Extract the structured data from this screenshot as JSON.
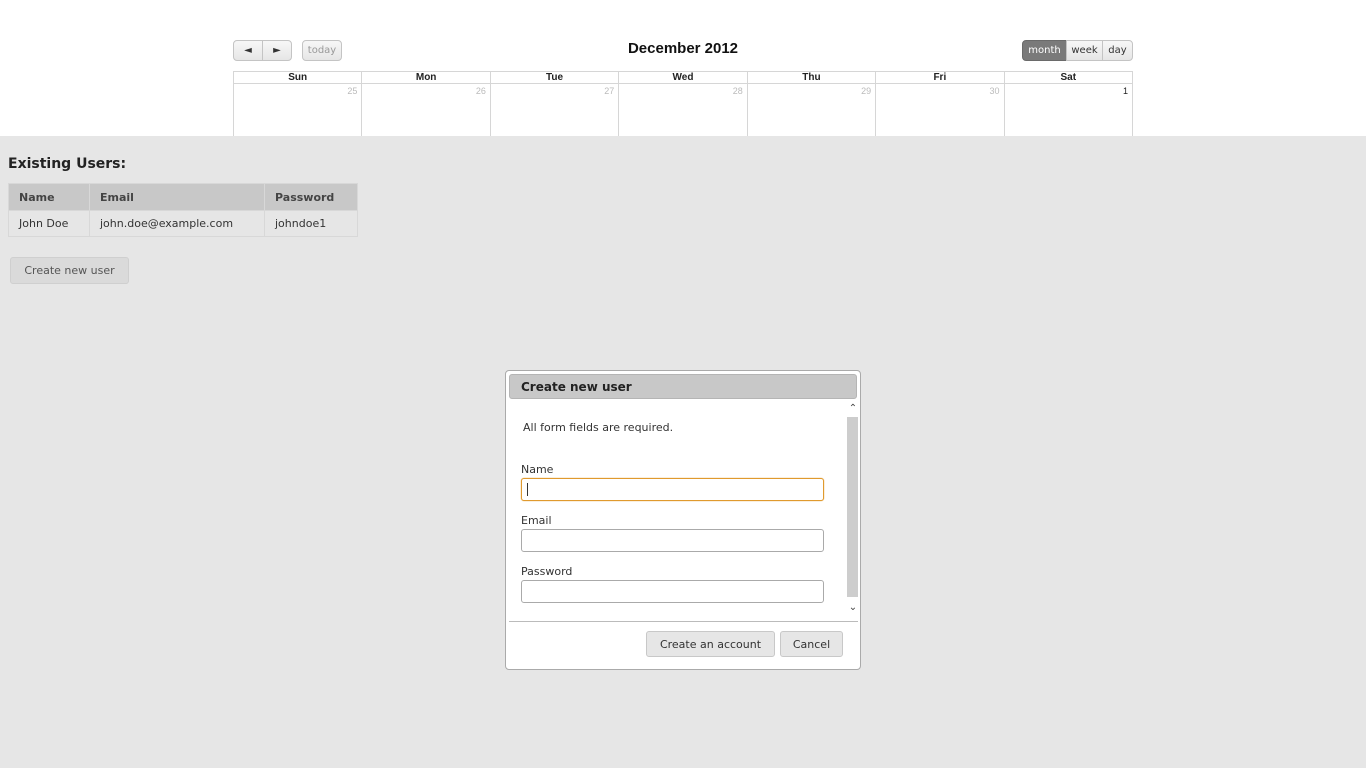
{
  "calendar": {
    "prev_label": "◄",
    "next_label": "►",
    "today_label": "today",
    "title": "December 2012",
    "views": {
      "month": "month",
      "week": "week",
      "day": "day"
    },
    "active_view": "month",
    "weekdays": [
      "Sun",
      "Mon",
      "Tue",
      "Wed",
      "Thu",
      "Fri",
      "Sat"
    ],
    "days": [
      "25",
      "26",
      "27",
      "28",
      "29",
      "30",
      "1"
    ]
  },
  "users": {
    "heading": "Existing Users:",
    "columns": [
      "Name",
      "Email",
      "Password"
    ],
    "rows": [
      {
        "name": "John Doe",
        "email": "john.doe@example.com",
        "password": "johndoe1"
      }
    ],
    "create_button": "Create new user"
  },
  "dialog": {
    "title": "Create new user",
    "note": "All form fields are required.",
    "fields": {
      "name": {
        "label": "Name",
        "value": ""
      },
      "email": {
        "label": "Email",
        "value": ""
      },
      "password": {
        "label": "Password",
        "value": ""
      }
    },
    "scroll_up": "⌃",
    "scroll_down": "⌄",
    "create_button": "Create an account",
    "cancel_button": "Cancel"
  },
  "colors": {
    "page_background": "#e6e6e6",
    "focus_border": "#e09a2e",
    "active_view_button": "#7a7a7a"
  }
}
